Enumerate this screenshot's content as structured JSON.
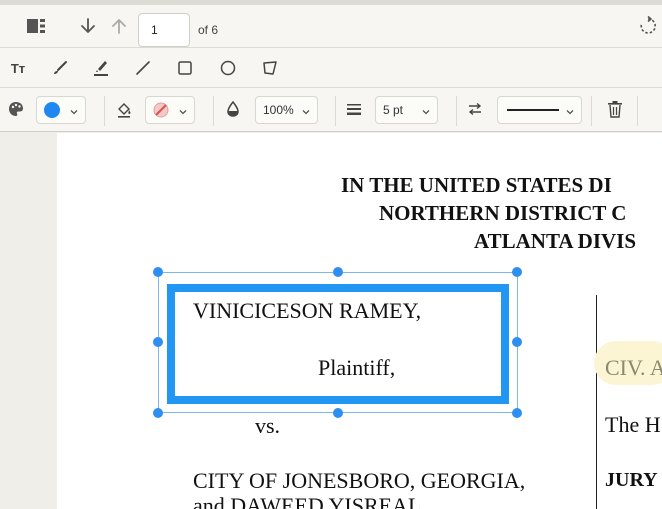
{
  "toolbar_top": {
    "page_number": "1",
    "page_of": "of 6",
    "icons": [
      "sidebar-toggle-icon",
      "arrow-down-icon",
      "arrow-up-icon",
      "rotate-icon"
    ]
  },
  "toolbar_tools": {
    "text_tool_glyph": "Tт",
    "tools": [
      "text-tool-icon",
      "brush-icon",
      "highlighter-icon",
      "line-icon",
      "rectangle-icon",
      "circle-icon",
      "polygon-icon"
    ]
  },
  "toolbar_props": {
    "stroke_color": "#1f87f0",
    "opacity": "100%",
    "line_width": "5 pt",
    "icons": [
      "palette-icon",
      "fill-bucket-icon",
      "no-fill-icon",
      "opacity-drop-icon",
      "line-weight-icon",
      "swap-icon",
      "trash-icon"
    ]
  },
  "document": {
    "header_line1": "IN THE UNITED STATES DI",
    "header_line2": "NORTHERN DISTRICT C",
    "header_line3": "ATLANTA DIVIS",
    "party_plaintiff": "VINICICESON RAMEY,",
    "plaintiff_role": "Plaintiff,",
    "versus": "vs.",
    "defendant_line1": "CITY OF JONESBORO, GEORGIA,",
    "defendant_line2": "and DAWEED YISREAL,",
    "case_label": "CIV. A",
    "the_text": "The H",
    "jury_text": "JURY"
  },
  "colors": {
    "accent": "#2196f3",
    "toolbar_bg": "#f7f6f2",
    "app_bg": "#efeee8",
    "highlight": "#fbf5d4"
  }
}
